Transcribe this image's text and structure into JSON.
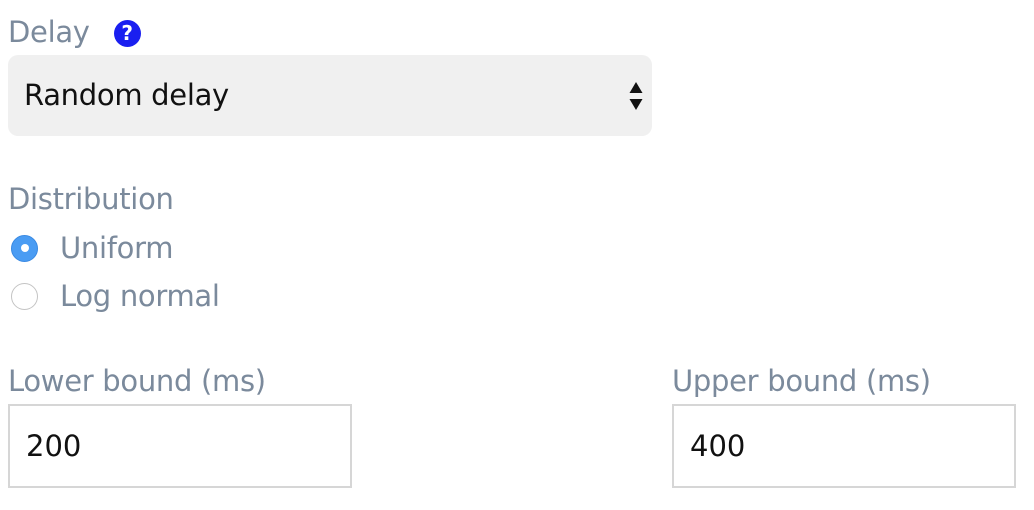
{
  "delay": {
    "label": "Delay",
    "help_icon": "question-circle-icon",
    "selected_value": "Random delay"
  },
  "distribution": {
    "label": "Distribution",
    "options": [
      {
        "label": "Uniform",
        "checked": true
      },
      {
        "label": "Log normal",
        "checked": false
      }
    ]
  },
  "lower_bound": {
    "label": "Lower bound (ms)",
    "value": "200"
  },
  "upper_bound": {
    "label": "Upper bound (ms)",
    "value": "400"
  },
  "colors": {
    "label_text": "#7b8a9c",
    "help_icon": "#1a1ff0",
    "radio_checked": "#4a9cf3",
    "select_background": "#f0f0f0"
  }
}
